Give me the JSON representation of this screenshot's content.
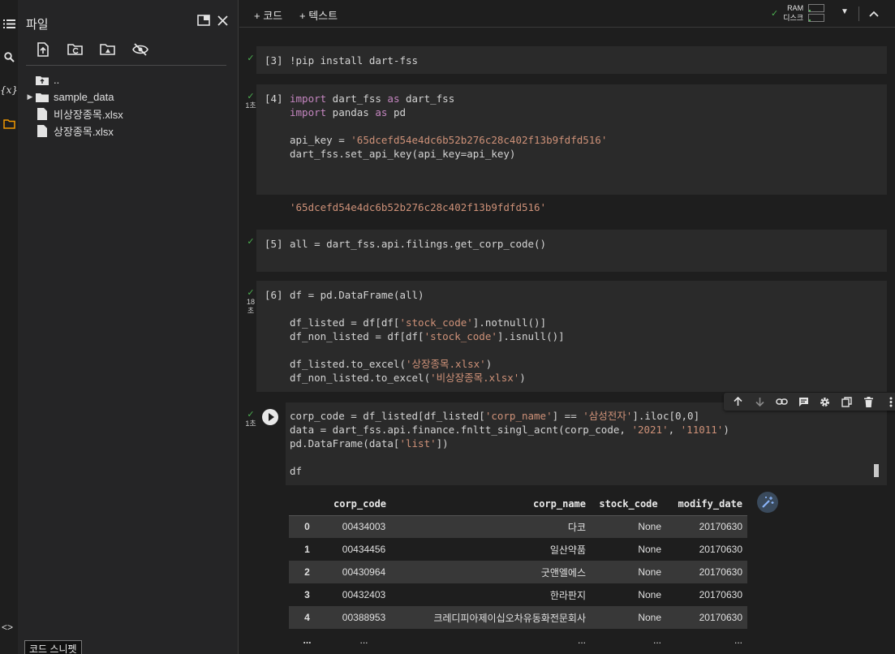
{
  "sidebar": {
    "title": "파일",
    "tree": [
      {
        "name": "..",
        "type": "parent"
      },
      {
        "name": "sample_data",
        "type": "folder"
      },
      {
        "name": "비상장종목.xlsx",
        "type": "file"
      },
      {
        "name": "상장종목.xlsx",
        "type": "file"
      }
    ],
    "code_toggle": "<>",
    "tooltip": "코드 스니펫"
  },
  "toolbar": {
    "add_code": "+ 코드",
    "add_text": "+ 텍스트",
    "ram_label": "RAM",
    "disk_label": "디스크",
    "ram_level": 0.1,
    "disk_level": 0.1
  },
  "cells": [
    {
      "exec": "[3]",
      "time": "",
      "code": "!pip install dart-fss"
    },
    {
      "exec": "[4]",
      "time": "1초",
      "output": "'65dcefd54e4dc6b52b276c28c402f13b9fdfd516'"
    },
    {
      "exec": "[5]",
      "time": "",
      "code": "all = dart_fss.api.filings.get_corp_code()"
    },
    {
      "exec": "[6]",
      "time": "18\n초"
    },
    {
      "exec": "",
      "time": "1초"
    }
  ],
  "code4": {
    "l1_kw1": "import",
    "l1_mid": " dart_fss ",
    "l1_kw2": "as",
    "l1_end": " dart_fss",
    "l2_kw1": "import",
    "l2_mid": " pandas ",
    "l2_kw2": "as",
    "l2_end": " pd",
    "l3_a": "api_key = ",
    "l3_s": "'65dcefd54e4dc6b52b276c28c402f13b9fdfd516'",
    "l4": "dart_fss.set_api_key(api_key=api_key)"
  },
  "code6": {
    "l1": "df = pd.DataFrame(all)",
    "l2_a": "df_listed = df[df[",
    "l2_s": "'stock_code'",
    "l2_b": "].notnull()]",
    "l3_a": "df_non_listed = df[df[",
    "l3_s": "'stock_code'",
    "l3_b": "].isnull()]",
    "l4_a": "df_listed.to_excel(",
    "l4_s": "'상장종목.xlsx'",
    "l4_b": ")",
    "l5_a": "df_non_listed.to_excel(",
    "l5_s": "'비상장종목.xlsx'",
    "l5_b": ")"
  },
  "code7": {
    "l1_a": "corp_code = df_listed[df_listed[",
    "l1_s1": "'corp_name'",
    "l1_b": "] == ",
    "l1_s2": "'삼성전자'",
    "l1_c": "].iloc[0,0]",
    "l2_a": "data = dart_fss.api.finance.fnltt_singl_acnt(corp_code, ",
    "l2_s1": "'2021'",
    "l2_b": ", ",
    "l2_s2": "'11011'",
    "l2_c": ")",
    "l3_a": "pd.DataFrame(data[",
    "l3_s": "'list'",
    "l3_b": "])",
    "l4": "df"
  },
  "dataframe": {
    "columns": [
      "",
      "corp_code",
      "corp_name",
      "stock_code",
      "modify_date"
    ],
    "rows": [
      [
        "0",
        "00434003",
        "다코",
        "None",
        "20170630"
      ],
      [
        "1",
        "00434456",
        "일산약품",
        "None",
        "20170630"
      ],
      [
        "2",
        "00430964",
        "굿앤엘에스",
        "None",
        "20170630"
      ],
      [
        "3",
        "00432403",
        "한라판지",
        "None",
        "20170630"
      ],
      [
        "4",
        "00388953",
        "크레디피아제이십오차유동화전문회사",
        "None",
        "20170630"
      ],
      [
        "...",
        "...",
        "...",
        "...",
        "..."
      ]
    ]
  }
}
